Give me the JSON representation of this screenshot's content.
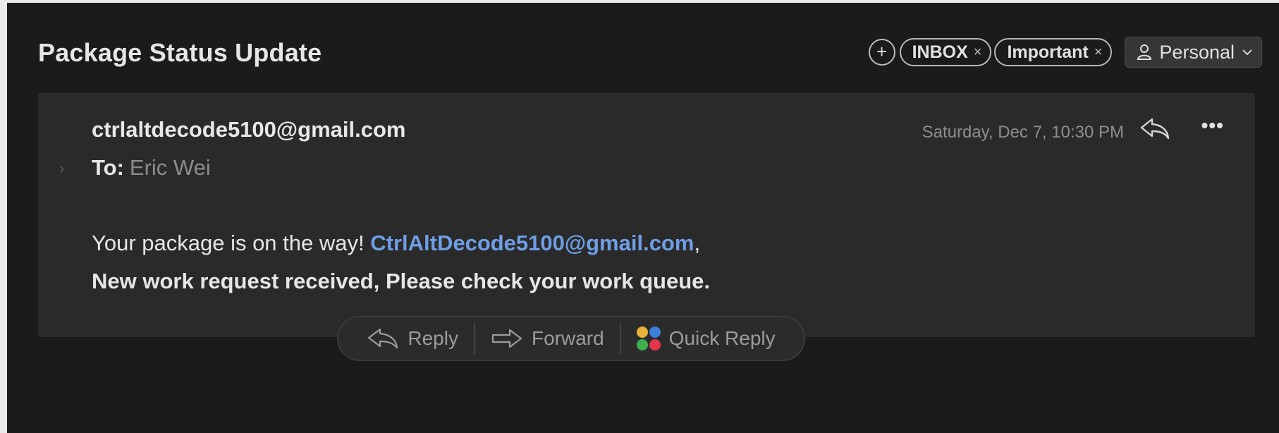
{
  "email": {
    "subject": "Package Status Update",
    "tags": [
      {
        "label": "INBOX",
        "remove": "×"
      },
      {
        "label": "Important",
        "remove": "×"
      }
    ],
    "account": {
      "label": "Personal",
      "icon": "person-icon"
    },
    "from": "ctrlaltdecode5100@gmail.com",
    "date": "Saturday, Dec 7, 10:30 PM",
    "to_label": "To:",
    "to_name": "Eric Wei",
    "expand_glyph": "›",
    "body": {
      "line1_text": "Your package is on the way! ",
      "line1_link": "CtrlAltDecode5100@gmail.com",
      "line1_suffix": ",",
      "line2": "New work request received, Please check your work queue."
    }
  },
  "actions": {
    "reply": "Reply",
    "forward": "Forward",
    "quick_reply": "Quick Reply"
  },
  "colors": {
    "background": "#1b1b1b",
    "card": "#2a2a2a",
    "link": "#6f9ee6",
    "muted": "#8e8e8e"
  }
}
